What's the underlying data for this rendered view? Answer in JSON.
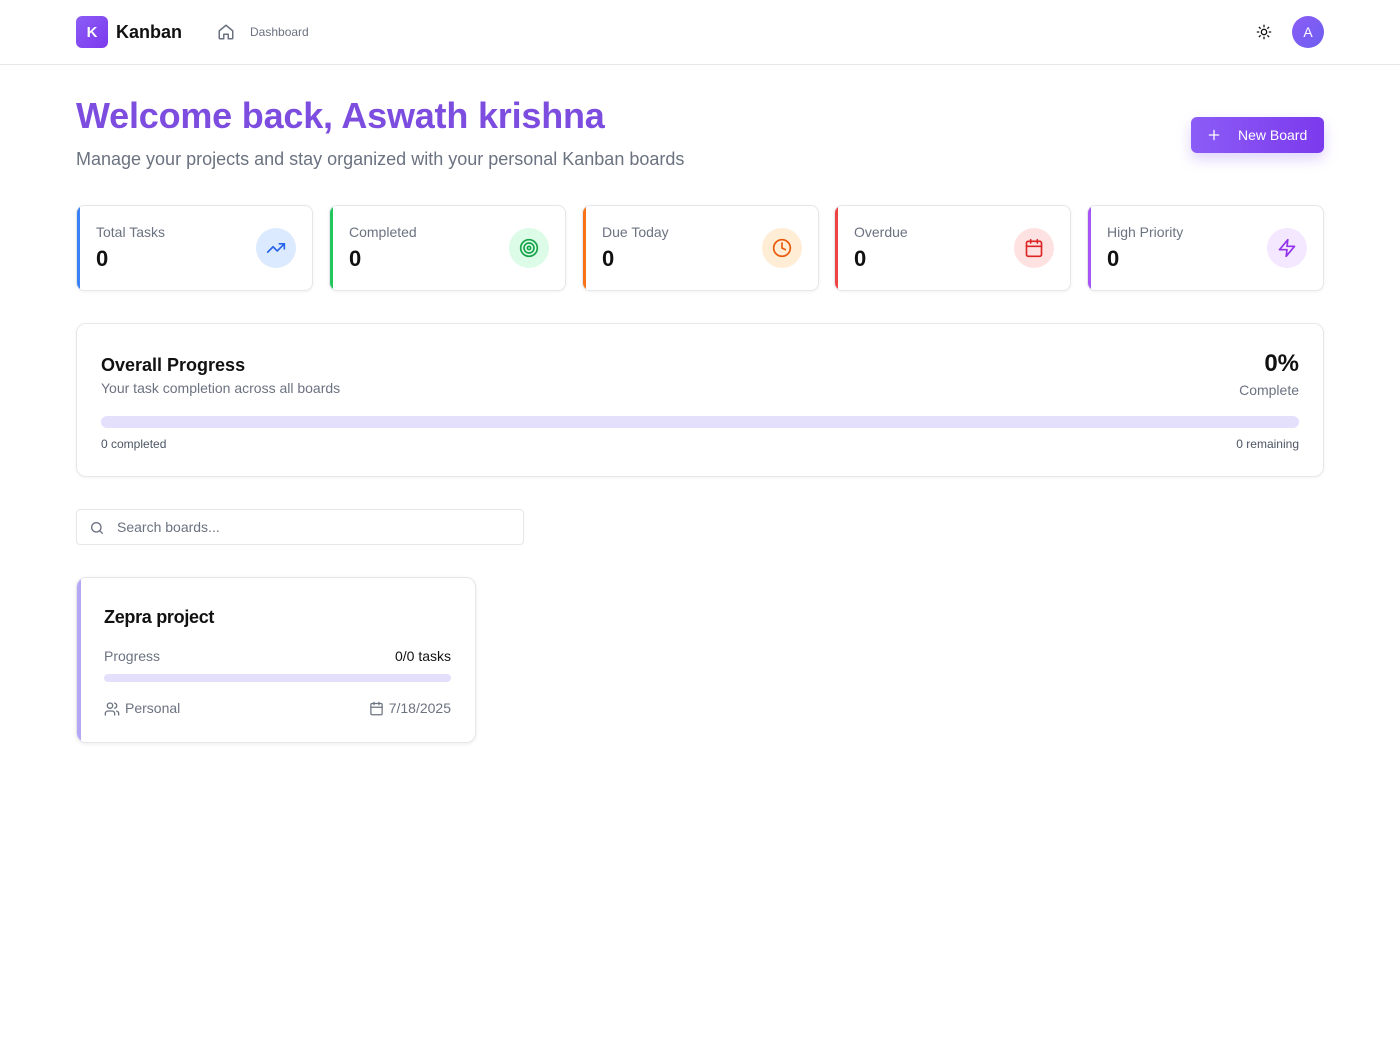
{
  "header": {
    "logo_letter": "K",
    "app_name": "Kanban",
    "nav": {
      "dashboard": "Dashboard"
    },
    "avatar_initial": "A",
    "icons": {
      "home": "home-icon",
      "theme": "sun-icon"
    }
  },
  "hero": {
    "welcome": "Welcome back, Aswath krishna",
    "subtitle": "Manage your projects and stay organized with your personal Kanban boards",
    "new_board_label": "New Board"
  },
  "stats": [
    {
      "label": "Total Tasks",
      "value": "0",
      "icon": "trending-up-icon",
      "accent": "#3b82f6",
      "tint": "#dbeafe"
    },
    {
      "label": "Completed",
      "value": "0",
      "icon": "target-icon",
      "accent": "#22c55e",
      "tint": "#dcfce7"
    },
    {
      "label": "Due Today",
      "value": "0",
      "icon": "clock-icon",
      "accent": "#f97316",
      "tint": "#ffedd5"
    },
    {
      "label": "Overdue",
      "value": "0",
      "icon": "calendar-icon",
      "accent": "#ef4444",
      "tint": "#fee2e2"
    },
    {
      "label": "High Priority",
      "value": "0",
      "icon": "zap-icon",
      "accent": "#a855f7",
      "tint": "#f3e8ff"
    }
  ],
  "progress": {
    "title": "Overall Progress",
    "subtitle": "Your task completion across all boards",
    "percent_label": "0%",
    "percent": 0,
    "complete_label": "Complete",
    "completed_text": "0 completed",
    "remaining_text": "0 remaining"
  },
  "search": {
    "placeholder": "Search boards...",
    "value": ""
  },
  "boards": [
    {
      "title": "Zepra project",
      "progress_label": "Progress",
      "tasks": "0/0 tasks",
      "progress": 0,
      "owner": "Personal",
      "date": "7/18/2025"
    }
  ],
  "colors": {
    "brand": "#7c3aed",
    "heading": "#7c4ddf",
    "progress_track": "#e4e0fb"
  }
}
